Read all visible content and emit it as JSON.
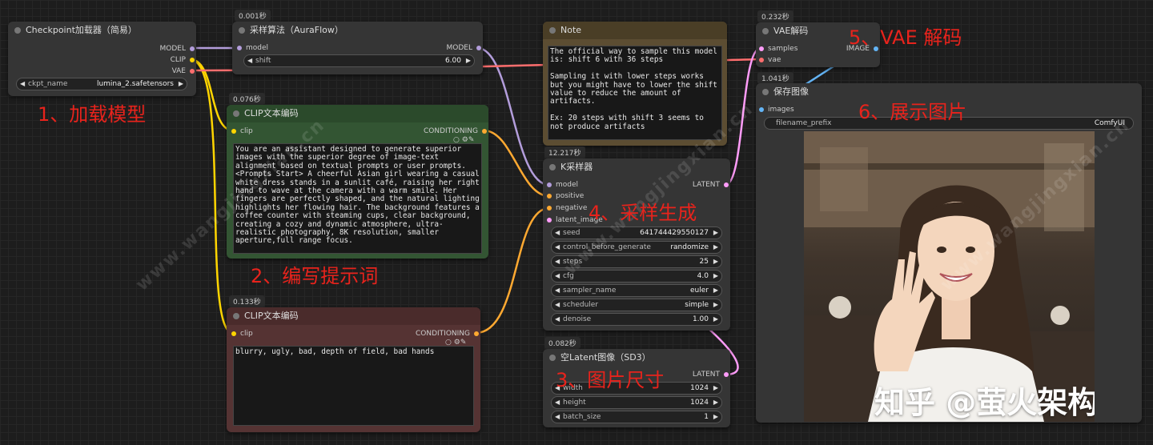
{
  "colors": {
    "model": "#b39ddb",
    "clip": "#ffd500",
    "vae": "#ff6e6e",
    "conditioning": "#ffa931",
    "latent": "#ff9cf9",
    "image": "#64b5f6",
    "annotation": "#e8231c"
  },
  "ckpt_node": {
    "title": "Checkpoint加载器（简易）",
    "out_model": "MODEL",
    "out_clip": "CLIP",
    "out_vae": "VAE",
    "widget_label": "ckpt_name",
    "widget_value": "lumina_2.safetensors"
  },
  "sampling_node": {
    "timer": "0.001秒",
    "title": "采样算法（AuraFlow）",
    "in_model": "model",
    "out_model": "MODEL",
    "widget_label": "shift",
    "widget_value": "6.00"
  },
  "clip_pos_node": {
    "timer": "0.076秒",
    "title": "CLIP文本编码",
    "in_clip": "clip",
    "out_cond": "CONDITIONING",
    "text": "You are an assistant designed to generate superior images with the superior degree of image-text alignment based on textual prompts or user prompts. <Prompts Start> A cheerful Asian girl wearing a casual white dress stands in a sunlit café, raising her right hand to wave at the camera with a warm smile. Her fingers are perfectly shaped, and the natural lighting highlights her flowing hair. The background features a coffee counter with steaming cups, clear background, creating a cozy and dynamic atmosphere, ultra-realistic photography, 8K resolution, smaller aperture,full range focus."
  },
  "clip_neg_node": {
    "timer": "0.133秒",
    "title": "CLIP文本编码",
    "in_clip": "clip",
    "out_cond": "CONDITIONING",
    "text": "blurry, ugly, bad, depth of field, bad hands"
  },
  "note_node": {
    "title": "Note",
    "text": "The official way to sample this model is: shift 6 with 36 steps\n\nSampling it with lower steps works but you might have to lower the shift value to reduce the amount of artifacts.\n\nEx: 20 steps with shift 3 seems to not produce artifacts"
  },
  "ksampler_node": {
    "timer": "12.217秒",
    "title": "K采样器",
    "in_model": "model",
    "in_positive": "positive",
    "in_negative": "negative",
    "in_latent": "latent_image",
    "out_latent": "LATENT",
    "widgets": [
      {
        "label": "seed",
        "value": "641744429550127"
      },
      {
        "label": "control_before_generate",
        "value": "randomize"
      },
      {
        "label": "steps",
        "value": "25"
      },
      {
        "label": "cfg",
        "value": "4.0"
      },
      {
        "label": "sampler_name",
        "value": "euler"
      },
      {
        "label": "scheduler",
        "value": "simple"
      },
      {
        "label": "denoise",
        "value": "1.00"
      }
    ]
  },
  "latent_node": {
    "timer": "0.082秒",
    "title": "空Latent图像（SD3）",
    "out_latent": "LATENT",
    "widgets": [
      {
        "label": "width",
        "value": "1024"
      },
      {
        "label": "height",
        "value": "1024"
      },
      {
        "label": "batch_size",
        "value": "1"
      }
    ]
  },
  "vae_node": {
    "timer": "0.232秒",
    "title": "VAE解码",
    "in_samples": "samples",
    "in_vae": "vae",
    "out_image": "IMAGE"
  },
  "save_node": {
    "timer": "1.041秒",
    "title": "保存图像",
    "in_images": "images",
    "widget_label": "filename_prefix",
    "widget_value": "ComfyUI"
  },
  "annotations": {
    "a1": "1、加载模型",
    "a2": "2、编写提示词",
    "a3": "3、图片尺寸",
    "a4": "4、采样生成",
    "a5": "5、VAE 解码",
    "a6": "6、展示图片"
  },
  "photo_watermark": "知乎 @萤火架构",
  "site_watermark": "www.wangjingxian.cn"
}
